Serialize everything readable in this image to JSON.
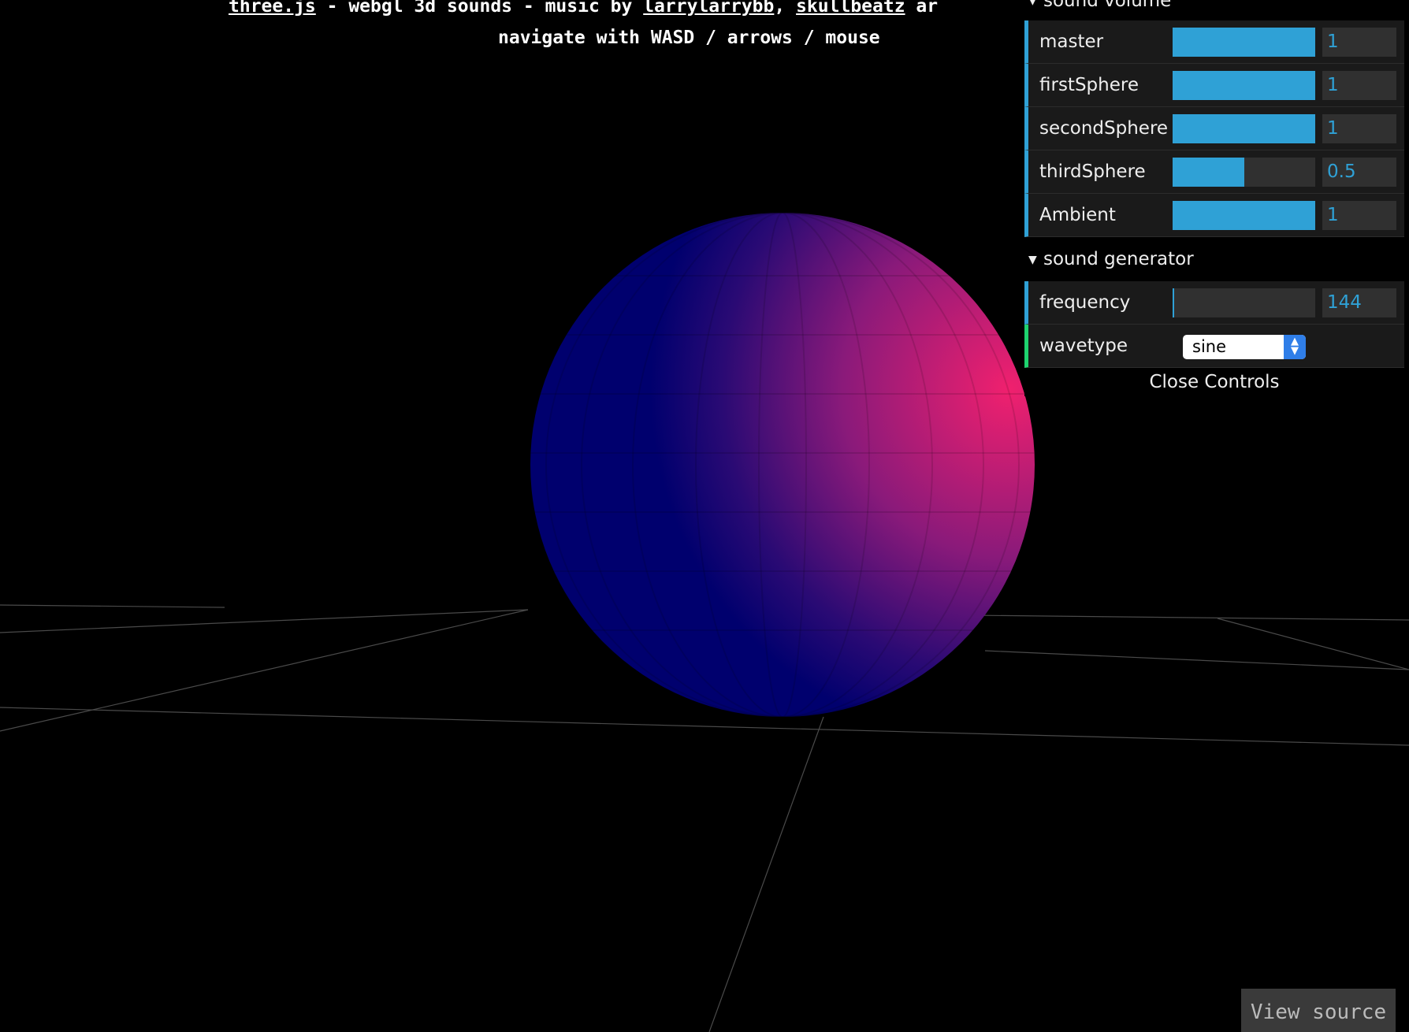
{
  "info": {
    "link_threejs": "three.js",
    "text_1": " - webgl 3d sounds - music by ",
    "link_larry": "larrylarrybb",
    "text_2": ", ",
    "link_skull": "skullbeatz",
    "text_3": " ar",
    "line_2": "navigate with WASD / arrows / mouse"
  },
  "gui": {
    "folder_volume": "sound volume",
    "rows": [
      {
        "label": "master",
        "value": "1",
        "fraction": 1.0
      },
      {
        "label": "firstSphere",
        "value": "1",
        "fraction": 1.0
      },
      {
        "label": "secondSphere",
        "value": "1",
        "fraction": 1.0
      },
      {
        "label": "thirdSphere",
        "value": "0.5",
        "fraction": 0.5
      },
      {
        "label": "Ambient",
        "value": "1",
        "fraction": 1.0
      }
    ],
    "folder_generator": "sound generator",
    "frequency": {
      "label": "frequency",
      "value": "144",
      "fraction": 0.0
    },
    "wavetype": {
      "label": "wavetype",
      "selected": "sine"
    },
    "close_label": "Close Controls"
  },
  "view_source": "View source",
  "colors": {
    "accent_blue": "#2fa1d6",
    "accent_green": "#1ed36f",
    "sphere_dark": "#00006e",
    "sphere_light": "#f0206e"
  }
}
